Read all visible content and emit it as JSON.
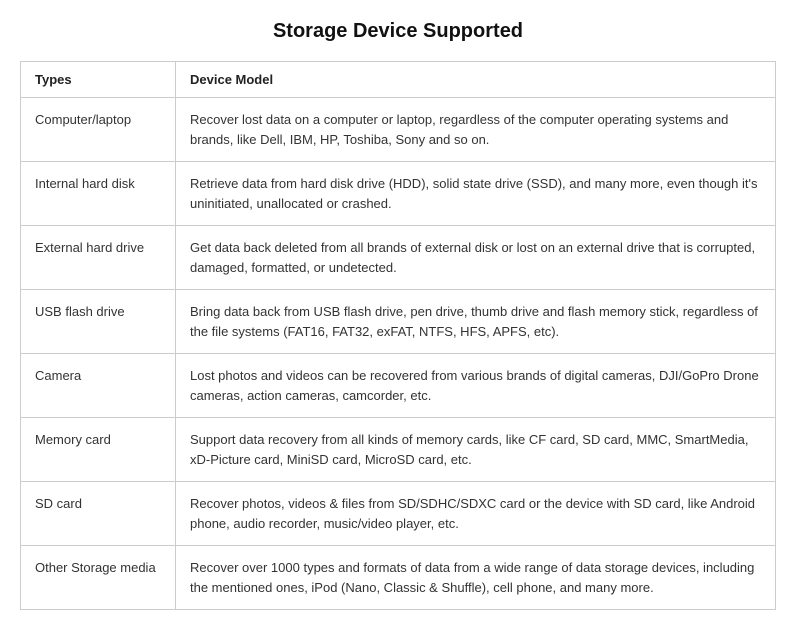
{
  "title": "Storage Device Supported",
  "table": {
    "headers": [
      "Types",
      "Device Model"
    ],
    "rows": [
      {
        "type": "Computer/laptop",
        "description": "Recover lost data on a computer or laptop, regardless of the computer operating systems and brands, like Dell, IBM, HP, Toshiba, Sony and so on."
      },
      {
        "type": "Internal hard disk",
        "description": "Retrieve data from hard disk drive (HDD), solid state drive (SSD), and many more, even though it's uninitiated, unallocated or crashed."
      },
      {
        "type": "External hard drive",
        "description": "Get data back deleted from all brands of external disk or lost on an external drive that is corrupted, damaged, formatted, or undetected."
      },
      {
        "type": "USB flash drive",
        "description": "Bring data back from USB flash drive, pen drive, thumb drive and flash memory stick, regardless of the file systems (FAT16, FAT32, exFAT, NTFS, HFS, APFS, etc)."
      },
      {
        "type": "Camera",
        "description": "Lost photos and videos can be recovered from various brands of digital cameras, DJI/GoPro Drone cameras, action cameras, camcorder, etc."
      },
      {
        "type": "Memory card",
        "description": "Support data recovery from all kinds of memory cards, like CF card, SD card, MMC, SmartMedia, xD-Picture card, MiniSD card, MicroSD card, etc."
      },
      {
        "type": "SD card",
        "description": "Recover photos, videos & files from SD/SDHC/SDXC card or the device with SD card, like Android phone, audio recorder, music/video player, etc."
      },
      {
        "type": "Other Storage media",
        "description": "Recover over 1000 types and formats of data from a wide range of data storage devices, including the mentioned ones, iPod (Nano, Classic & Shuffle), cell phone, and many more."
      }
    ]
  }
}
